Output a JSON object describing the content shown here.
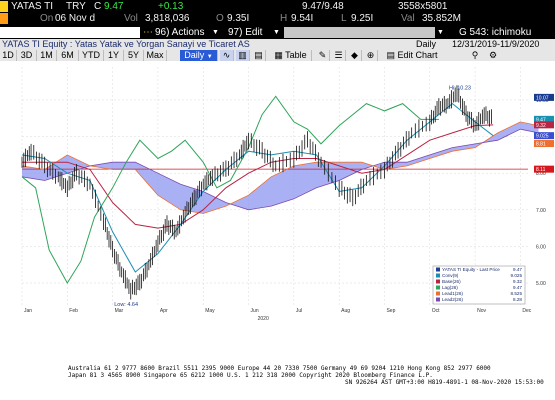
{
  "ticker": {
    "symbol": "YATAS TI",
    "currency": "TRY",
    "last_prefix": "C",
    "last": "9.47",
    "change": "+0.13",
    "bid_ask": "9.47/9.48",
    "size": "3558x5801",
    "on_label": "On",
    "date": "06 Nov d",
    "vol_label": "Vol",
    "vol": "3,818,036",
    "open_label": "O",
    "open": "9.35I",
    "high_label": "H",
    "high": "9.54I",
    "low_label": "L",
    "low": "9.25I",
    "val_label": "Val",
    "val": "35.852M"
  },
  "fnbar": {
    "go_ticker": "YATAS TI Equity",
    "actions_label": "96) Actions",
    "edit_label": "97) Edit",
    "function_title": "G 543: ichimoku"
  },
  "titlebar": {
    "security_name": "YATAS TI Equity : Yatas Yatak ve Yorgan Sanayi ve Ticaret AS",
    "frequency": "Daily",
    "range": "12/31/2019-11/9/2020"
  },
  "rangebar": {
    "buttons": [
      "1D",
      "3D",
      "1M",
      "6M",
      "YTD",
      "1Y",
      "5Y",
      "Max"
    ],
    "frequency_select": "Daily",
    "table_label": "Table",
    "edit_chart_label": "Edit Chart"
  },
  "chart_data": {
    "type": "line",
    "title": "",
    "xlabel": "2020",
    "ylabel": "",
    "x_tick_labels": [
      "Jan",
      "Feb",
      "Mar",
      "Apr",
      "May",
      "Jun",
      "Jul",
      "Aug",
      "Sep",
      "Oct",
      "Nov",
      "Dec"
    ],
    "y_tick_labels": [
      "5.00",
      "6.00",
      "7.00",
      "8.00",
      "9.00",
      "10.00"
    ],
    "ylim": [
      4.4,
      10.9
    ],
    "hline": 8.11,
    "low_label": "Low: 4.64",
    "high_label": "Hi: 10.23",
    "legend": {
      "placement": "bottom-right",
      "entries": [
        {
          "name": "YATAS TI Equity - Last Price",
          "value": "9.47",
          "color": "#1f3f9a"
        },
        {
          "name": "Conv(9)",
          "value": "9.025",
          "color": "#1a8fb0"
        },
        {
          "name": "Base(26)",
          "value": "9.32",
          "color": "#b82443"
        },
        {
          "name": "Lag(26)",
          "value": "9.47",
          "color": "#2fa45a"
        },
        {
          "name": "Lead1(26)",
          "value": "8.525",
          "color": "#ef6f2f"
        },
        {
          "name": "Lead2(26)",
          "value": "8.28",
          "color": "#7a4ab0"
        }
      ]
    },
    "right_value_tags": [
      {
        "value": "10.07",
        "color": "#1a3a8e"
      },
      {
        "value": "9.47",
        "color": "#1a8fb0"
      },
      {
        "value": "9.32",
        "color": "#b82443"
      },
      {
        "value": "9.025",
        "color": "#3a4fd0"
      },
      {
        "value": "8.81",
        "color": "#ef6f2f"
      },
      {
        "value": "8.11",
        "color": "#d6181e"
      }
    ],
    "series": [
      {
        "name": "Last Price",
        "dates": [
          0.0,
          0.2,
          0.5,
          0.8,
          1.0,
          1.2,
          1.5,
          1.8,
          2.0,
          2.2,
          2.4,
          2.6,
          2.8,
          3.0,
          3.2,
          3.4,
          3.6,
          3.8,
          4.0,
          4.2,
          4.5,
          4.8,
          5.0,
          5.3,
          5.6,
          6.0,
          6.3,
          6.6,
          7.0,
          7.3,
          7.6,
          8.0,
          8.3,
          8.6,
          9.0,
          9.2,
          9.4,
          9.6,
          9.8,
          10.0,
          10.2,
          10.4
        ],
        "values": [
          8.3,
          8.6,
          8.2,
          7.9,
          7.6,
          8.0,
          7.7,
          6.7,
          5.9,
          5.3,
          4.8,
          5.0,
          5.5,
          6.1,
          6.6,
          6.4,
          6.9,
          7.3,
          7.7,
          7.9,
          8.1,
          8.5,
          8.9,
          8.6,
          8.2,
          8.4,
          8.9,
          8.3,
          7.6,
          7.3,
          7.8,
          8.1,
          8.6,
          9.1,
          9.4,
          9.8,
          9.9,
          10.2,
          9.6,
          9.3,
          9.6,
          9.47
        ]
      },
      {
        "name": "Conv(9)",
        "dates": [
          0.0,
          0.5,
          1.0,
          1.5,
          2.0,
          2.5,
          3.0,
          3.5,
          4.0,
          4.5,
          5.0,
          5.5,
          6.0,
          6.5,
          7.0,
          7.5,
          8.0,
          8.5,
          9.0,
          9.5,
          10.0,
          10.4
        ],
        "values": [
          8.5,
          8.4,
          8.0,
          7.8,
          6.4,
          5.3,
          5.8,
          6.6,
          7.5,
          8.1,
          8.6,
          8.5,
          8.6,
          8.5,
          7.5,
          7.6,
          8.2,
          8.9,
          9.4,
          9.9,
          9.4,
          9.025
        ]
      },
      {
        "name": "Base(26)",
        "dates": [
          0.0,
          0.5,
          1.0,
          1.5,
          2.0,
          2.5,
          3.0,
          3.5,
          4.0,
          4.5,
          5.0,
          5.5,
          6.0,
          6.5,
          7.0,
          7.5,
          8.0,
          8.5,
          9.0,
          9.5,
          10.0,
          10.4
        ],
        "values": [
          8.3,
          8.3,
          8.3,
          8.1,
          7.2,
          6.6,
          6.5,
          6.6,
          7.0,
          7.6,
          8.0,
          8.3,
          8.4,
          8.4,
          8.2,
          8.0,
          8.1,
          8.5,
          8.9,
          9.1,
          9.3,
          9.32
        ]
      },
      {
        "name": "Lag(26)",
        "dates": [
          0.0,
          0.3,
          0.6,
          1.0,
          1.3,
          1.6,
          2.0,
          2.3,
          2.6,
          3.0,
          3.3,
          3.6,
          4.0,
          4.3,
          4.6,
          5.0,
          5.3,
          5.6,
          6.0,
          6.3,
          6.6,
          7.0,
          7.3,
          7.6,
          8.0,
          8.4,
          8.8,
          9.2
        ],
        "values": [
          7.9,
          7.6,
          5.9,
          5.0,
          5.6,
          6.8,
          7.6,
          8.3,
          8.9,
          8.4,
          8.6,
          8.9,
          8.3,
          7.6,
          7.8,
          8.7,
          9.6,
          10.1,
          9.4,
          9.2,
          8.8,
          9.3,
          9.6,
          9.9,
          9.7,
          9.9,
          9.47,
          9.47
        ]
      },
      {
        "name": "Lead1(26)",
        "dates": [
          0.0,
          0.5,
          1.0,
          1.5,
          2.0,
          2.5,
          3.0,
          3.5,
          4.0,
          4.5,
          5.0,
          5.5,
          6.0,
          6.5,
          7.0,
          7.5,
          8.0,
          8.5,
          9.0,
          9.5,
          10.0,
          10.5,
          11.0,
          11.4
        ],
        "values": [
          8.2,
          8.1,
          8.5,
          8.2,
          8.1,
          8.1,
          7.4,
          7.0,
          6.9,
          7.1,
          7.4,
          7.9,
          8.2,
          8.3,
          8.3,
          8.3,
          8.1,
          8.2,
          8.4,
          8.6,
          8.7,
          9.1,
          9.4,
          9.3
        ]
      },
      {
        "name": "Lead2(26)",
        "dates": [
          0.0,
          0.5,
          1.0,
          1.5,
          2.0,
          2.5,
          3.0,
          3.5,
          4.0,
          4.5,
          5.0,
          5.5,
          6.0,
          6.5,
          7.0,
          7.5,
          8.0,
          8.5,
          9.0,
          9.5,
          10.0,
          10.5,
          11.0,
          11.4
        ],
        "values": [
          7.9,
          7.8,
          8.0,
          8.2,
          8.3,
          8.3,
          8.0,
          7.7,
          7.5,
          7.2,
          7.0,
          7.1,
          7.3,
          7.6,
          7.8,
          8.1,
          8.3,
          8.3,
          8.5,
          8.7,
          8.8,
          8.9,
          9.2,
          9.1
        ]
      }
    ]
  },
  "footer": {
    "line1": "Australia 61 2 9777 8600 Brazil 5511 2395 9000 Europe 44 20 7330 7500 Germany 49 69 9204 1210 Hong Kong 852 2977 6000",
    "line2": "Japan 81 3 4565 8900        Singapore 65 6212 1000      U.S. 1 212 318 2000        Copyright 2020 Bloomberg Finance L.P.",
    "line3": "SN 926264 AST  GMT+3:00 H819-4891-1 08-Nov-2020 15:53:00"
  }
}
